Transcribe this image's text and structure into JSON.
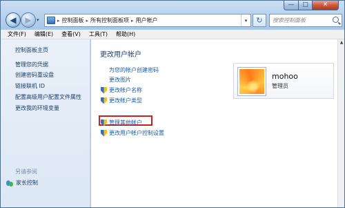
{
  "window": {
    "caption_min": "—",
    "caption_max": "□",
    "caption_close": "✕"
  },
  "nav": {
    "back": "◀",
    "forward": "▶",
    "dropdown": "▾"
  },
  "address": {
    "separator": "▸",
    "crumbs": [
      "控制面板",
      "所有控制面板项",
      "用户帐户"
    ],
    "dropdown": "▾"
  },
  "refresh": "↻",
  "search": {
    "placeholder": "搜索控制面板"
  },
  "menu": [
    "文件(F)",
    "编辑(E)",
    "查看(V)",
    "工具(T)",
    "帮助(H)"
  ],
  "sidebar": {
    "home": "控制面板主页",
    "links": [
      "管理您的凭据",
      "创建密码重设盘",
      "链接联机 ID",
      "配置高级用户配置文件属性",
      "更改我的环境变量"
    ],
    "see_also": "另请参阅",
    "parental_controls": "家长控制"
  },
  "main": {
    "title": "更改用户帐户",
    "tasks": [
      "为您的帐户创建密码",
      "更改图片",
      "更改帐户名称",
      "更改帐户类型",
      "管理其他帐户",
      "更改用户帐户控制设置"
    ]
  },
  "user": {
    "name": "mohoo",
    "role": "管理员"
  },
  "colors": {
    "link": "#1c5aa6",
    "title": "#1f3e73",
    "highlight": "#c81e1e"
  }
}
